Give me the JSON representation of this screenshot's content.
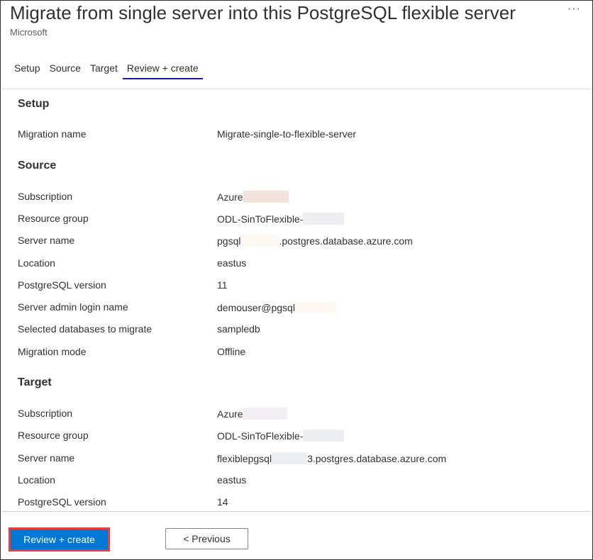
{
  "header": {
    "title": "Migrate from single server into this PostgreSQL flexible server",
    "subtitle": "Microsoft",
    "more_label": "···"
  },
  "tabs": [
    {
      "label": "Setup"
    },
    {
      "label": "Source"
    },
    {
      "label": "Target"
    },
    {
      "label": "Review + create",
      "active": true
    }
  ],
  "setup": {
    "heading": "Setup",
    "rows": [
      {
        "label": "Migration name",
        "value": "Migrate-single-to-flexible-server"
      }
    ]
  },
  "source": {
    "heading": "Source",
    "subscription": {
      "label": "Subscription",
      "value": "Azure"
    },
    "resource_group": {
      "label": "Resource group",
      "value": "ODL-SinToFlexible-"
    },
    "server_name": {
      "label": "Server name",
      "value_prefix": "pgsql",
      "value_suffix": ".postgres.database.azure.com"
    },
    "location": {
      "label": "Location",
      "value": "eastus"
    },
    "version": {
      "label": "PostgreSQL version",
      "value": "11"
    },
    "admin_login": {
      "label": "Server admin login name",
      "value": "demouser@pgsql"
    },
    "databases": {
      "label": "Selected databases to migrate",
      "value": "sampledb"
    },
    "mode": {
      "label": "Migration mode",
      "value": "Offline"
    }
  },
  "target": {
    "heading": "Target",
    "subscription": {
      "label": "Subscription",
      "value": "Azure"
    },
    "resource_group": {
      "label": "Resource group",
      "value": "ODL-SinToFlexible-"
    },
    "server_name": {
      "label": "Server name",
      "value_prefix": "flexiblepgsql",
      "value_suffix": "3.postgres.database.azure.com"
    },
    "location": {
      "label": "Location",
      "value": "eastus"
    },
    "version": {
      "label": "PostgreSQL version",
      "value": "14"
    }
  },
  "footer": {
    "review_create_label": "Review + create",
    "previous_label": "< Previous"
  },
  "colors": {
    "primary": "#0078d4",
    "highlight_border": "#e04040",
    "tab_underline": "#1a1aa0"
  }
}
